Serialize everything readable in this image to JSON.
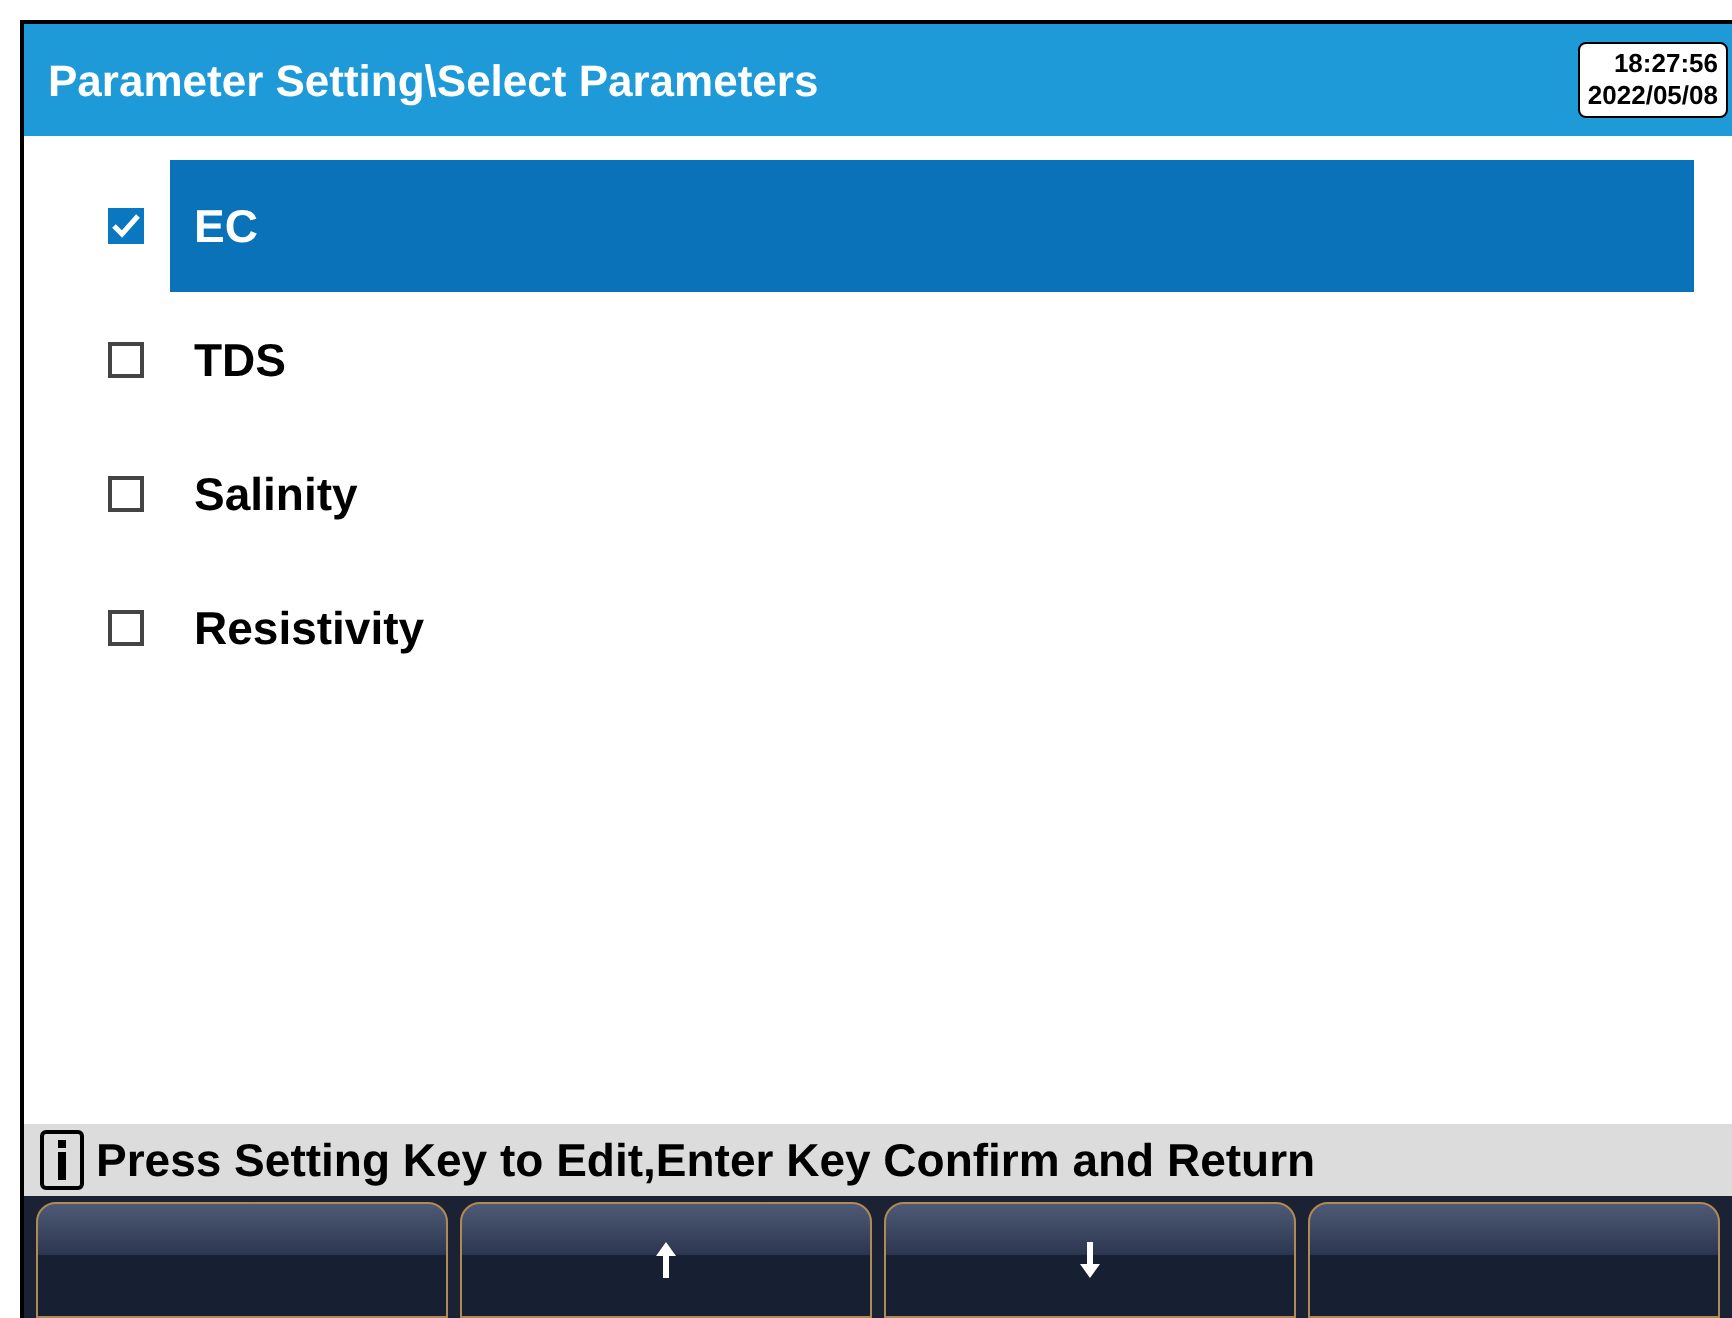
{
  "title_bar": {
    "title": "Parameter Setting\\Select Parameters",
    "time": "18:27:56",
    "date": "2022/05/08"
  },
  "parameters": [
    {
      "label": "EC",
      "checked": true,
      "selected": true
    },
    {
      "label": "TDS",
      "checked": false,
      "selected": false
    },
    {
      "label": "Salinity",
      "checked": false,
      "selected": false
    },
    {
      "label": "Resistivity",
      "checked": false,
      "selected": false
    }
  ],
  "status_bar": {
    "message": "Press Setting Key to Edit,Enter Key Confirm and Return"
  },
  "softkeys": [
    {
      "kind": "blank"
    },
    {
      "kind": "up"
    },
    {
      "kind": "down"
    },
    {
      "kind": "blank"
    }
  ]
}
